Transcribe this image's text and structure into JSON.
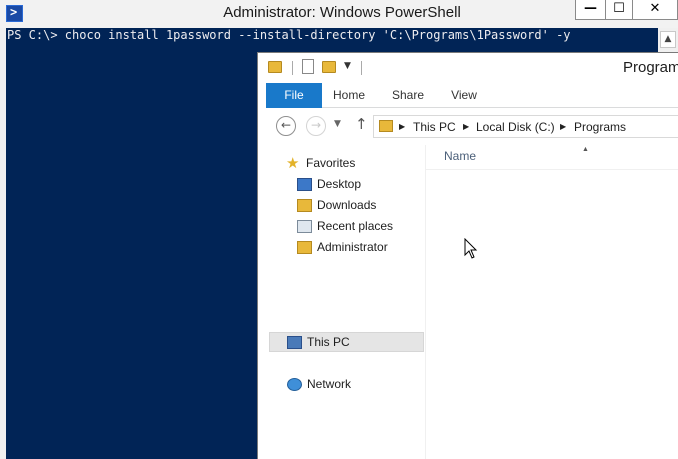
{
  "powershell": {
    "title": "Administrator: Windows PowerShell",
    "window_controls": {
      "minimize": "—",
      "maximize": "☐",
      "close": "✕"
    },
    "command_line": "PS C:\\> choco install 1password --install-directory 'C:\\Programs\\1Password' -y",
    "colors": {
      "console_bg": "#012456",
      "console_fg": "#eeedf0"
    }
  },
  "explorer": {
    "title": "Programs",
    "ribbon_tabs": [
      "File",
      "Home",
      "Share",
      "View"
    ],
    "breadcrumb": [
      "This PC",
      "Local Disk (C:)",
      "Programs"
    ],
    "nav_pane": {
      "favorites_label": "Favorites",
      "favorites": [
        "Desktop",
        "Downloads",
        "Recent places",
        "Administrator"
      ],
      "this_pc": "This PC",
      "network": "Network"
    },
    "columns": {
      "name": "Name"
    },
    "colors": {
      "file_tab": "#1979ca"
    }
  }
}
